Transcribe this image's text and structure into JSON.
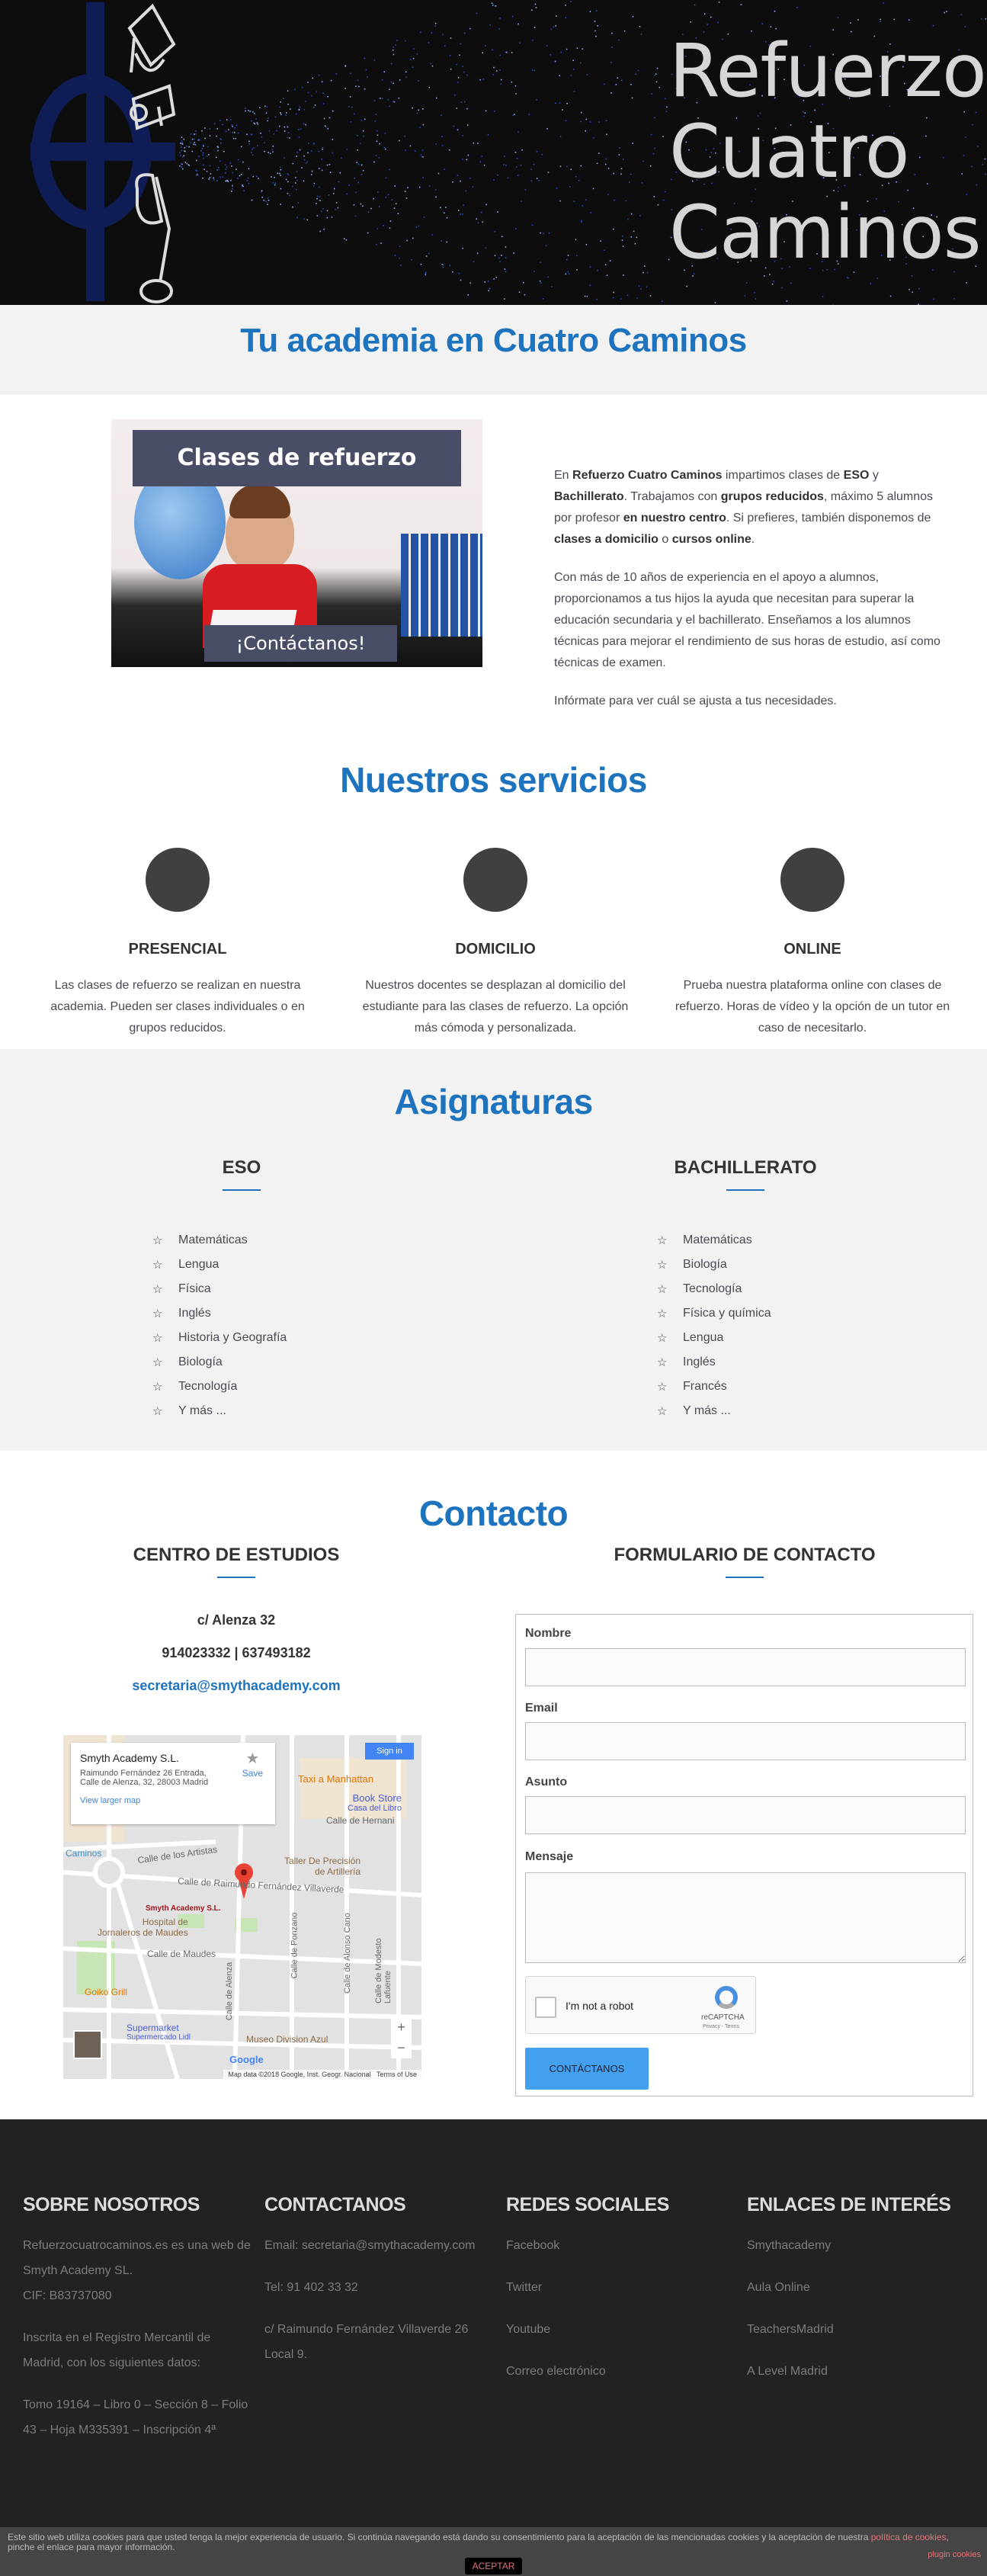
{
  "hero": {
    "logo_lines": [
      "Refuerzo",
      "Cuatro",
      "Caminos"
    ]
  },
  "band": {
    "title": "Tu academia en Cuatro Caminos"
  },
  "intro": {
    "image_title": "Clases de refuerzo",
    "image_cta": "¡Contáctanos!",
    "p1": [
      {
        "t": "En ",
        "b": false
      },
      {
        "t": "Refuerzo Cuatro Caminos",
        "b": true
      },
      {
        "t": " impartimos clases de ",
        "b": false
      },
      {
        "t": "ESO",
        "b": true
      },
      {
        "t": " y ",
        "b": false
      },
      {
        "t": "Bachillerato",
        "b": true
      },
      {
        "t": ". Trabajamos con ",
        "b": false
      },
      {
        "t": "grupos reducidos",
        "b": true
      },
      {
        "t": ", máximo 5 alumnos por profesor ",
        "b": false
      },
      {
        "t": "en nuestro centro",
        "b": true
      },
      {
        "t": ". Si prefieres, también disponemos de ",
        "b": false
      },
      {
        "t": "clases a domicilio",
        "b": true
      },
      {
        "t": " o ",
        "b": false
      },
      {
        "t": "cursos online",
        "b": true
      },
      {
        "t": ".",
        "b": false
      }
    ],
    "p2": "Con más de 10 años de experiencia en el apoyo a alumnos, proporcionamos a tus hijos la ayuda que necesitan para superar la educación secundaria y el bachillerato. Enseñamos a los alumnos técnicas para mejorar el rendimiento de sus horas de estudio, así como técnicas de examen.",
    "p3": "Infórmate para ver cuál se ajusta a tus necesidades."
  },
  "services": {
    "title": "Nuestros servicios",
    "items": [
      {
        "title": "PRESENCIAL",
        "text": "Las clases de refuerzo se realizan en nuestra academia.  Pueden ser clases individuales o en grupos reducidos."
      },
      {
        "title": "DOMICILIO",
        "text": "Nuestros docentes se desplazan al domicilio del estudiante para las clases de refuerzo. La opción más cómoda y personalizada."
      },
      {
        "title": "ONLINE",
        "text": "Prueba nuestra plataforma online con clases de refuerzo. Horas de vídeo y la opción de un tutor en caso de necesitarlo."
      }
    ]
  },
  "subjects": {
    "title": "Asignaturas",
    "eso": {
      "title": "ESO",
      "items": [
        "Matemáticas",
        "Lengua",
        "Física",
        "Inglés",
        "Historia y Geografía",
        "Biología",
        "Tecnología",
        "Y más ..."
      ]
    },
    "bach": {
      "title": "BACHILLERATO",
      "items": [
        "Matemáticas",
        "Biología",
        "Tecnología",
        "Física y química",
        "Lengua",
        "Inglés",
        "Francés",
        "Y más ..."
      ]
    }
  },
  "contact": {
    "title": "Contacto",
    "center_title": "CENTRO DE ESTUDIOS",
    "address": "c/ Alenza 32",
    "phones": "914023332 | 637493182",
    "email": "secretaria@smythacademy.com",
    "form_title": "FORMULARIO DE CONTACTO",
    "fields": {
      "name": "Nombre",
      "email": "Email",
      "subject": "Asunto",
      "message": "Mensaje"
    },
    "captcha": {
      "label": "I'm not a robot",
      "brand": "reCAPTCHA",
      "links": "Privacy - Terms"
    },
    "submit": "CONTÁCTANOS",
    "map": {
      "place": "Smyth Academy S.L.",
      "addr1": "Raimundo Fernández 26 Entrada,",
      "addr2": "Calle de Alenza, 32, 28003 Madrid",
      "save": "Save",
      "larger": "View larger map",
      "signin": "Sign in",
      "labels": {
        "taxi": "Taxi a Manhattan",
        "book": "Book Store",
        "book2": "Casa del Libro",
        "hernani": "Calle de Hernani",
        "caminos": "Caminos",
        "artistas": "Calle de los Artistas",
        "taller": "Taller De Precisión",
        "taller2": "de Artillería",
        "raimundo": "Calle de Raimundo Fernández Villaverde",
        "pin": "Smyth Academy S.L.",
        "hospital": "Hospital de",
        "hospital2": "Jornaleros de Maudes",
        "maudes": "Calle de Maudes",
        "goiko": "Goiko Grill",
        "super": "Supermarket",
        "super2": "Supermercado Lidl",
        "museo": "Museo Division Azul",
        "alenza": "Calle de Alenza",
        "ponzano": "Calle de Ponzano",
        "alonso": "Calle de Alonso Cano",
        "modesto": "Calle de Modesto Lafuente"
      },
      "attribution": "Map data ©2018 Google, Inst. Geogr. Nacional",
      "terms": "Terms of Use",
      "google": "Google"
    }
  },
  "footer": {
    "cols": [
      {
        "title": "SOBRE NOSOTROS",
        "lines": [
          "Refuerzocuatrocaminos.es es una web de Smyth Academy SL.",
          "CIF: B83737080",
          "",
          "Inscrita en el Registro Mercantil de Madrid, con los siguientes datos:",
          "",
          "Tomo 19164 – Libro 0 – Sección 8 – Folio 43 – Hoja M335391 – Inscripción 4ª"
        ]
      },
      {
        "title": "CONTACTANOS",
        "lines": [
          "Email: secretaria@smythacademy.com",
          "",
          "Tel: 91 402 33 32",
          "",
          "c/ Raimundo Fernández Villaverde 26 Local 9."
        ]
      },
      {
        "title": "REDES SOCIALES",
        "links": [
          "Facebook",
          "Twitter",
          "Youtube",
          "Correo electrónico"
        ]
      },
      {
        "title": "ENLACES DE INTERÉS",
        "links": [
          "Smythacademy",
          "Aula Online",
          "TeachersMadrid",
          "A Level Madrid"
        ]
      }
    ]
  },
  "cookie": {
    "text": "Este sitio web utiliza cookies para que usted tenga la mejor experiencia de usuario. Si continúa navegando está dando su consentimiento para la aceptación de las mencionadas cookies y la aceptación de nuestra ",
    "link": "política de cookies",
    "text2": ", pinche el enlace para mayor información.",
    "plugin": "plugin cookies",
    "accept": "ACEPTAR"
  },
  "colors": {
    "accent": "#1e73be",
    "footer_bg": "#222222",
    "button": "#42a0ee",
    "cookie_link": "#e0747a"
  }
}
